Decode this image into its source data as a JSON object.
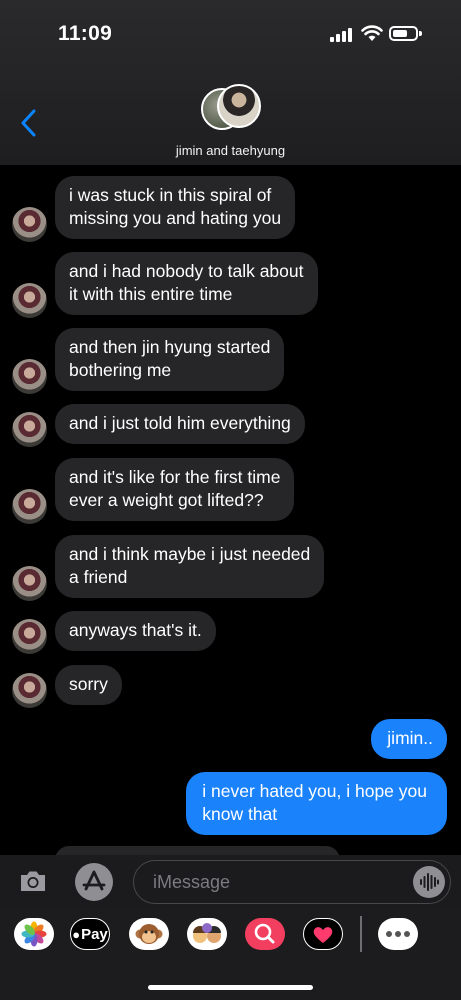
{
  "status_bar": {
    "time": "11:09"
  },
  "header": {
    "title": "jimin and taehyung"
  },
  "messages": [
    {
      "dir": "in",
      "text": "i was stuck in this spiral of\nmissing you and hating you"
    },
    {
      "dir": "in",
      "text": "and i had nobody to talk about\nit with this entire time"
    },
    {
      "dir": "in",
      "text": "and then jin hyung started\nbothering me"
    },
    {
      "dir": "in",
      "text": "and i just told him everything"
    },
    {
      "dir": "in",
      "text": "and it's like for the first time\never a weight got lifted??"
    },
    {
      "dir": "in",
      "text": "and i think maybe i just needed\na friend"
    },
    {
      "dir": "in",
      "text": "anyways that's it."
    },
    {
      "dir": "in",
      "text": "sorry"
    },
    {
      "dir": "out",
      "text": "jimin.."
    },
    {
      "dir": "out",
      "text": "i never hated you, i hope you\nknow that"
    }
  ],
  "input": {
    "placeholder": "iMessage"
  },
  "app_drawer": {
    "items": [
      {
        "name": "photos-app-icon"
      },
      {
        "name": "apple-pay-app-icon",
        "label": "Pay"
      },
      {
        "name": "animoji-app-icon"
      },
      {
        "name": "memoji-app-icon"
      },
      {
        "name": "search-images-app-icon"
      },
      {
        "name": "digital-touch-app-icon"
      },
      {
        "name": "more-apps-icon"
      }
    ]
  },
  "colors": {
    "incoming_bubble": "#262628",
    "outgoing_bubble": "#1a82fb",
    "accent": "#0a84ff"
  }
}
